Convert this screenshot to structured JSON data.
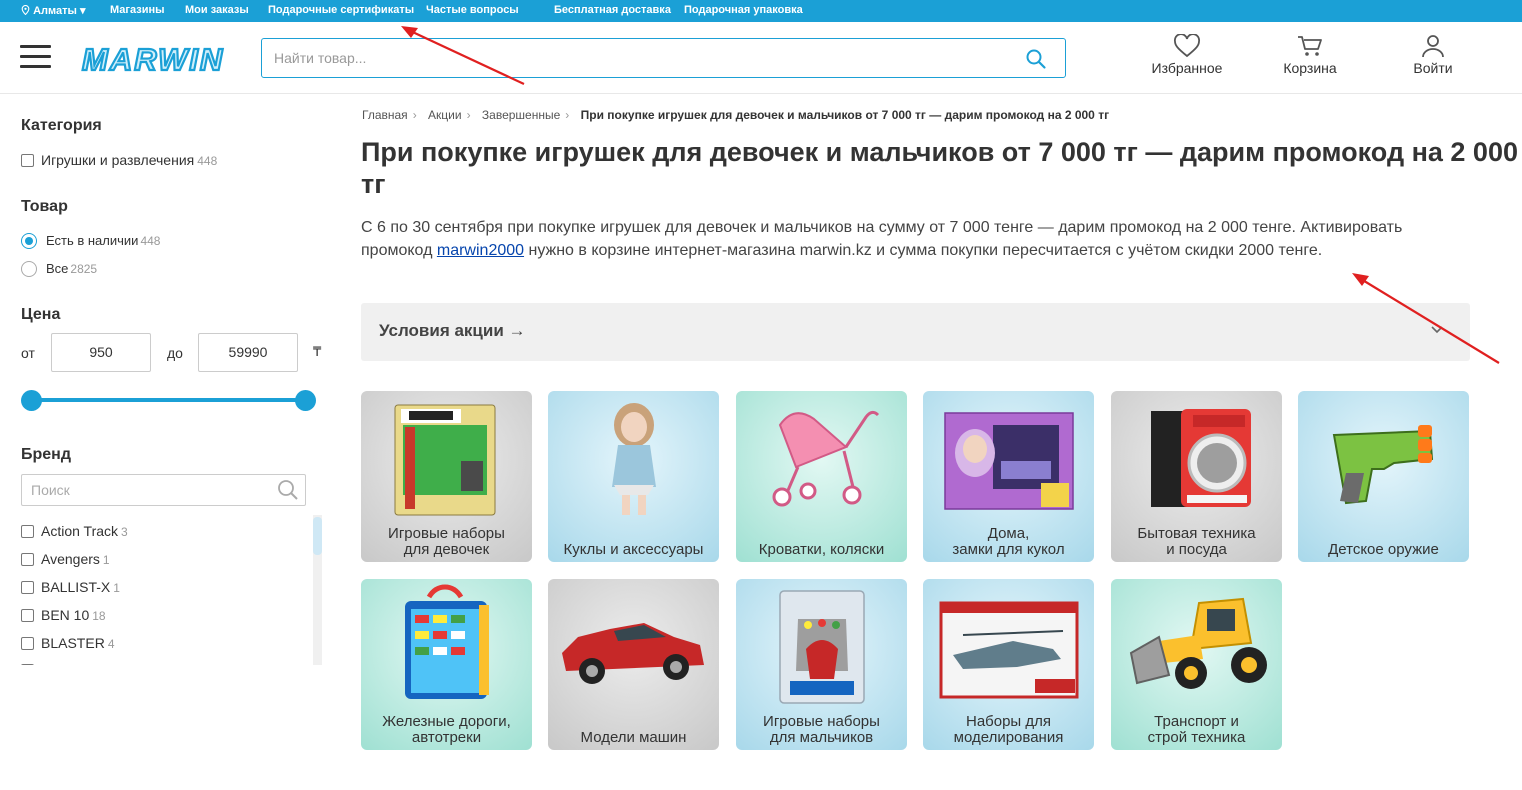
{
  "topbar": {
    "city": "Алматы",
    "links": [
      "Магазины",
      "Мои заказы",
      "Подарочные сертификаты",
      "Частые вопросы",
      "Бесплатная доставка",
      "Подарочная упаковка"
    ]
  },
  "header": {
    "logo_text": "MARWIN",
    "search_placeholder": "Найти товар...",
    "favorites": "Избранное",
    "cart": "Корзина",
    "login": "Войти"
  },
  "sidebar": {
    "category_title": "Категория",
    "categories": [
      {
        "label": "Игрушки и развлечения",
        "count": "448"
      }
    ],
    "stock_title": "Товар",
    "stock_options": [
      {
        "label": "Есть в наличии",
        "count": "448",
        "selected": true
      },
      {
        "label": "Все",
        "count": "2825",
        "selected": false
      }
    ],
    "price_title": "Цена",
    "price_from_label": "от",
    "price_to_label": "до",
    "price_min": "950",
    "price_max": "59990",
    "currency": "₸",
    "brand_title": "Бренд",
    "brand_search_placeholder": "Поиск",
    "brands": [
      {
        "label": "Action Track",
        "count": "3"
      },
      {
        "label": "Avengers",
        "count": "1"
      },
      {
        "label": "BALLIST-X",
        "count": "1"
      },
      {
        "label": "BEN 10",
        "count": "18"
      },
      {
        "label": "BLASTER",
        "count": "4"
      }
    ]
  },
  "breadcrumbs": {
    "items": [
      "Главная",
      "Акции",
      "Завершенные"
    ],
    "current": "При покупке игрушек для девочек и мальчиков от 7 000 тг — дарим промокод на 2 000 тг"
  },
  "main": {
    "title": "При покупке игрушек для девочек и мальчиков от 7 000 тг — дарим промокод на 2 000 тг",
    "desc_part1": "С 6 по 30 сентября при покупке игрушек для девочек и мальчиков на сумму от 7 000 тенге — дарим промокод на 2 000 тенге. Активировать промокод ",
    "promo_code": "marwin2000",
    "desc_part2": " нужно в корзине интернет-магазина marwin.kz и сумма покупки пересчитается с учётом скидки 2000 тенге.",
    "conditions_label": "Условия акции →"
  },
  "categories": [
    {
      "label": "Игровые наборы\nдля девочек",
      "icon": "stikbot-studio-icon",
      "bg": "gray"
    },
    {
      "label": "Куклы и аксессуары",
      "icon": "doll-icon",
      "bg": "blue"
    },
    {
      "label": "Кроватки, коляски",
      "icon": "doll-stroller-icon",
      "bg": "teal"
    },
    {
      "label": "Дома,\nзамки для кукол",
      "icon": "doll-house-icon",
      "bg": "blue"
    },
    {
      "label": "Бытовая техника\nи посуда",
      "icon": "washing-machine-icon",
      "bg": "gray"
    },
    {
      "label": "Детское оружие",
      "icon": "toy-blaster-icon",
      "bg": "blue"
    },
    {
      "label": "Железные дороги,\nавтотреки",
      "icon": "car-case-icon",
      "bg": "teal"
    },
    {
      "label": "Модели машин",
      "icon": "model-car-icon",
      "bg": "gray"
    },
    {
      "label": "Игровые наборы\nдля мальчиков",
      "icon": "gauntlet-icon",
      "bg": "blue"
    },
    {
      "label": "Наборы для\nмоделирования",
      "icon": "helicopter-kit-icon",
      "bg": "blue"
    },
    {
      "label": "Транспорт и\nстрой техника",
      "icon": "bulldozer-icon",
      "bg": "teal"
    }
  ],
  "colors": {
    "brand_blue": "#1ba0d6",
    "annotation_red": "#e02020"
  }
}
